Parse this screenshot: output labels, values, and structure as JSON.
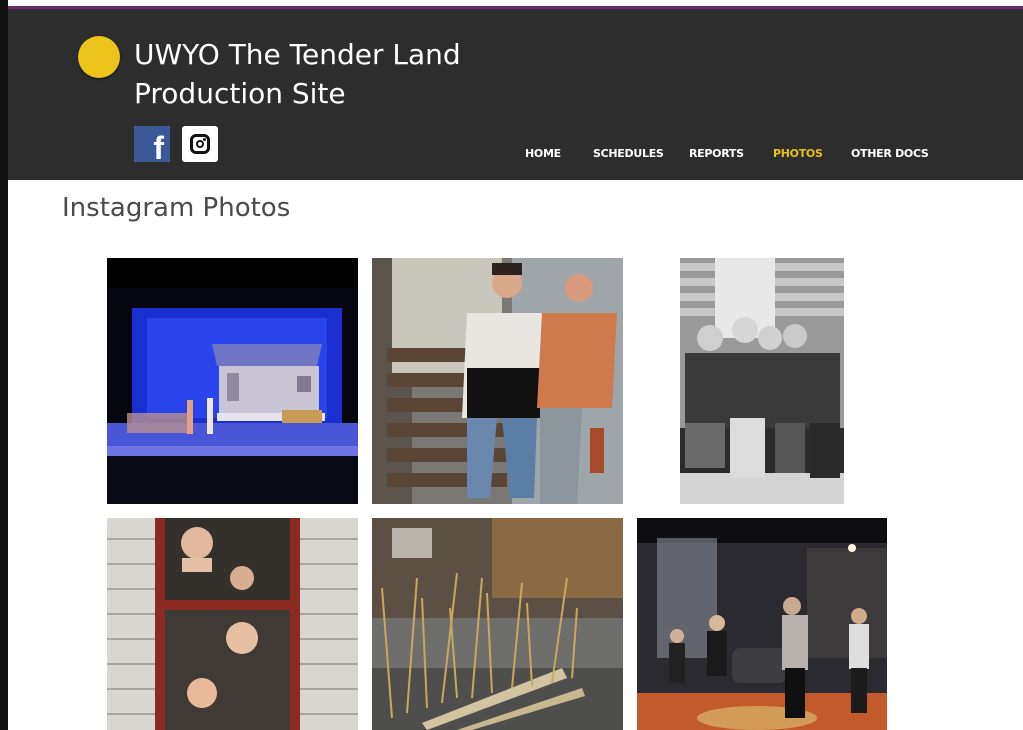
{
  "site": {
    "title": "UWYO The Tender Land Production Site",
    "title_line1": "UWYO The Tender Land",
    "title_line2": "Production Site",
    "logo_color": "#ecc41c"
  },
  "social": {
    "facebook_icon": "f",
    "instagram_icon": "instagram-icon"
  },
  "nav": {
    "items": [
      "HOME",
      "SCHEDULES",
      "REPORTS",
      "PHOTOS",
      "OTHER DOCS"
    ],
    "active": "PHOTOS",
    "active_color": "#e6c21e"
  },
  "main": {
    "section_title": "Instagram Photos",
    "photos": [
      {
        "subject": "stage-set-farmhouse"
      },
      {
        "subject": "two-actors-laughing-on-stairs"
      },
      {
        "subject": "four-women-sitting-bw"
      },
      {
        "subject": "faces-in-window-frame"
      },
      {
        "subject": "wheat-props-workshop"
      },
      {
        "subject": "dancers-rehearsal"
      }
    ]
  },
  "colors": {
    "header_bg": "#2d2d2d",
    "accent_line": "#6a2a6a",
    "facebook_blue": "#3b5998"
  }
}
